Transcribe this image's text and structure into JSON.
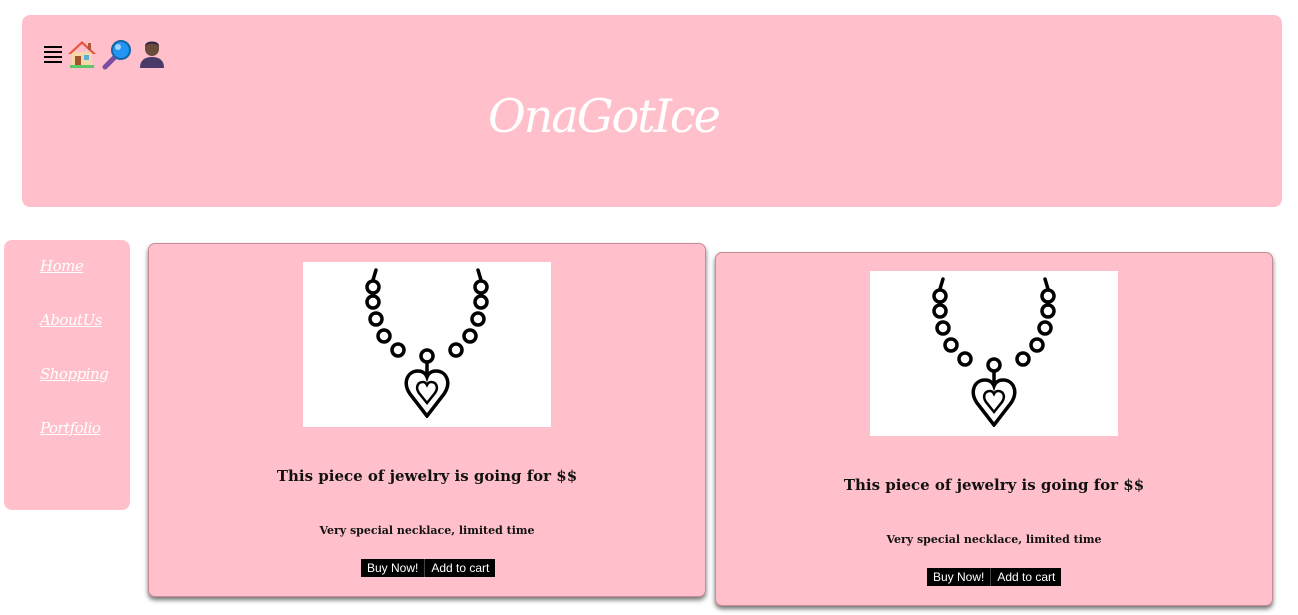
{
  "header": {
    "brand": "OnaGotIce",
    "icons": [
      "menu-icon",
      "home-icon",
      "search-icon",
      "user-icon"
    ]
  },
  "sidebar": {
    "items": [
      {
        "label": "Home"
      },
      {
        "label": "AboutUs"
      },
      {
        "label": "Shopping"
      },
      {
        "label": "Portfolio"
      }
    ]
  },
  "products": [
    {
      "title": "This piece of jewelry is going for $$",
      "description": "Very special necklace, limited time",
      "buy_label": "Buy Now!",
      "cart_label": "Add to cart",
      "image_icon": "necklace-icon"
    },
    {
      "title": "This piece of jewelry is going for $$",
      "description": "Very special necklace, limited time",
      "buy_label": "Buy Now!",
      "cart_label": "Add to cart",
      "image_icon": "necklace-icon"
    }
  ],
  "colors": {
    "accent": "#ffc0cb",
    "button_bg": "#000000",
    "button_text": "#ffffff"
  }
}
